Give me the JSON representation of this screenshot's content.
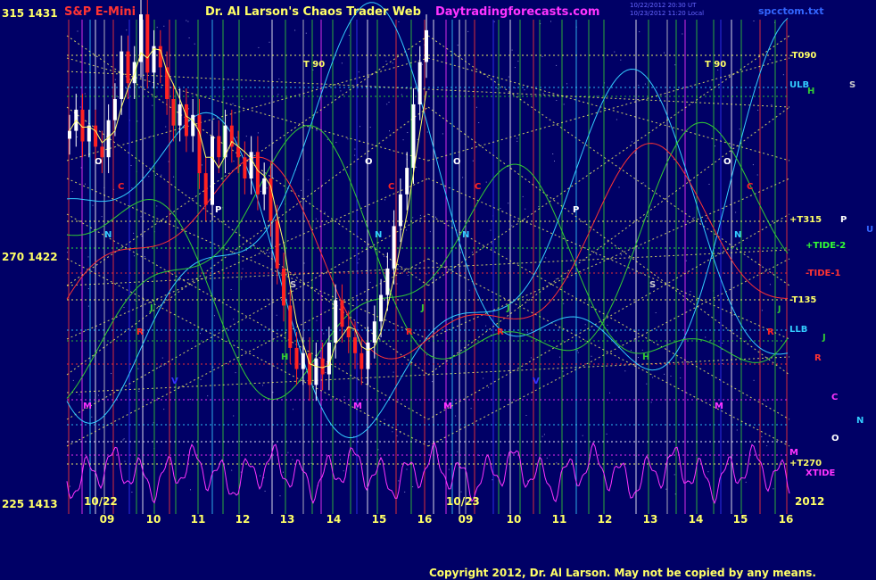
{
  "header": {
    "title_left": "S&P E-Mini",
    "title_center": "Dr. Al Larson's Chaos Trader Web",
    "title_site": "Daytradingforecasts.com",
    "file_name": "spcctom.txt",
    "timestamp_1": "10/22/2012 20:30 UT",
    "timestamp_2": "10/23/2012 11:20 Local"
  },
  "y_axis": {
    "top_label": "315  1431",
    "mid_label": "270  1422",
    "bottom_label": "225  1413"
  },
  "x_axis": {
    "date_left": "10/22",
    "date_right": "10/23",
    "year": "2012",
    "hours": [
      "09",
      "10",
      "11",
      "12",
      "13",
      "14",
      "15",
      "16",
      "10",
      "09",
      "10",
      "11",
      "12",
      "13",
      "14",
      "15",
      "16"
    ]
  },
  "right_labels": {
    "t090": "-T090",
    "ulb": "ULB",
    "h": "H",
    "s": "S",
    "t315": "+T315",
    "p": "P",
    "u": "U",
    "tide2": "+TIDE-2",
    "tide1": "-TIDE-1",
    "t135": "-T135",
    "j_small": "J",
    "llb": "LLB",
    "j": "J",
    "r": "R",
    "c": "C",
    "n": "N",
    "o": "O",
    "m": "M",
    "t270": "+T270",
    "xtide": "XTIDE"
  },
  "plot_markers": [
    {
      "t": "T  90",
      "c": "#ffff66"
    },
    {
      "t": "T  90",
      "c": "#ffff66"
    },
    {
      "t": "O",
      "c": "#ffffff"
    },
    {
      "t": "O",
      "c": "#ffffff"
    },
    {
      "t": "O",
      "c": "#ffffff"
    },
    {
      "t": "O",
      "c": "#ffffff"
    },
    {
      "t": "C",
      "c": "#ff2222"
    },
    {
      "t": "C",
      "c": "#ff2222"
    },
    {
      "t": "C",
      "c": "#ff2222"
    },
    {
      "t": "C",
      "c": "#ff2222"
    },
    {
      "t": "P",
      "c": "#ffffff"
    },
    {
      "t": "P",
      "c": "#ffffff"
    },
    {
      "t": "N",
      "c": "#33ccff"
    },
    {
      "t": "N",
      "c": "#33ccff"
    },
    {
      "t": "N",
      "c": "#33ccff"
    },
    {
      "t": "N",
      "c": "#33ccff"
    },
    {
      "t": "S",
      "c": "#cccccc"
    },
    {
      "t": "S",
      "c": "#cccccc"
    },
    {
      "t": "J",
      "c": "#33cc33"
    },
    {
      "t": "J",
      "c": "#33cc33"
    },
    {
      "t": "J",
      "c": "#33cc33"
    },
    {
      "t": "R",
      "c": "#ff2222"
    },
    {
      "t": "R",
      "c": "#ff2222"
    },
    {
      "t": "R",
      "c": "#ff2222"
    },
    {
      "t": "R",
      "c": "#ff2222"
    },
    {
      "t": "H",
      "c": "#33cc33"
    },
    {
      "t": "H",
      "c": "#33cc33"
    },
    {
      "t": "V",
      "c": "#3333ff"
    },
    {
      "t": "V",
      "c": "#3333ff"
    },
    {
      "t": "M",
      "c": "#ff33ff"
    },
    {
      "t": "M",
      "c": "#ff33ff"
    },
    {
      "t": "M",
      "c": "#ff33ff"
    },
    {
      "t": "M",
      "c": "#ff33ff"
    }
  ],
  "copyright": "Copyright 2012, Dr. Al Larson. May not be copied by any means.",
  "colors": {
    "background": "#000066",
    "grid_green": "#339933",
    "flux_yellow": "#ffff66",
    "price_up": "#ffffff",
    "price_down": "#ff2222",
    "title_red": "#ff3333",
    "title_yellow": "#ffff66",
    "title_magenta": "#ff33ff",
    "xtide_magenta": "#ff33ff"
  },
  "chart_data": {
    "type": "line",
    "title": "S&P E-Mini",
    "ylim_price": [
      1413,
      1431
    ],
    "ylim_angle": [
      225,
      315
    ],
    "y_ticks_price": [
      1431,
      1422,
      1413
    ],
    "y_ticks_angle": [
      315,
      270,
      225
    ],
    "price_series_close": [
      1426.8,
      1427.6,
      1426.4,
      1427.0,
      1426.2,
      1425.8,
      1427.2,
      1428.0,
      1429.8,
      1428.6,
      1429.4,
      1431.2,
      1429.0,
      1430.0,
      1429.2,
      1428.0,
      1427.0,
      1427.8,
      1426.6,
      1427.4,
      1425.2,
      1424.0,
      1426.6,
      1425.8,
      1427.0,
      1426.2,
      1425.8,
      1425.0,
      1426.0,
      1424.4,
      1425.0,
      1423.4,
      1421.6,
      1420.2,
      1418.6,
      1417.8,
      1418.4,
      1417.2,
      1418.2,
      1417.6,
      1418.8,
      1420.4,
      1419.4,
      1419.0,
      1418.4,
      1417.8,
      1418.8,
      1419.6,
      1420.6,
      1421.6,
      1423.2,
      1424.4,
      1425.4,
      1427.8,
      1429.4,
      1430.6
    ]
  }
}
